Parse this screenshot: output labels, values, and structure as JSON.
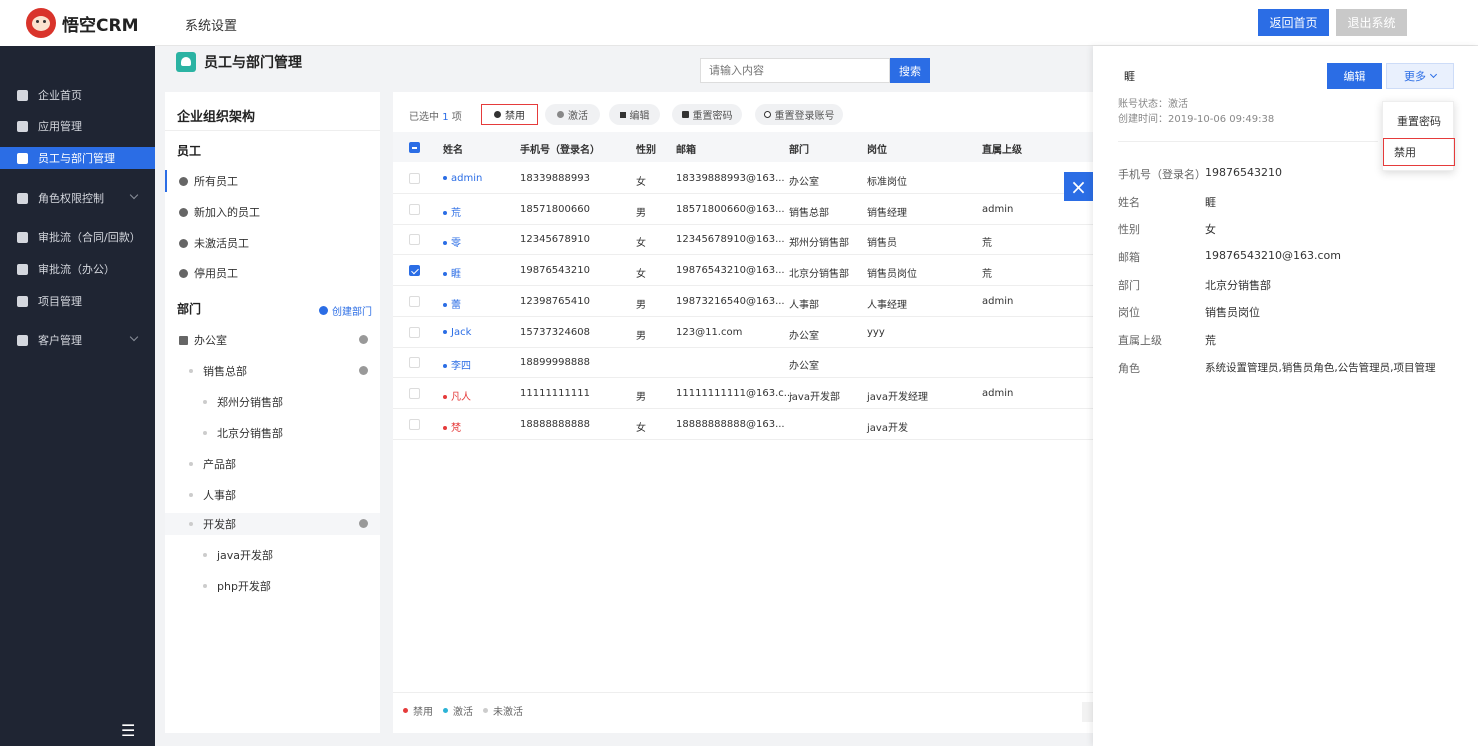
{
  "app": {
    "name": "悟空CRM",
    "section": "系统设置"
  },
  "top_buttons": {
    "home": "返回首页",
    "exit": "退出系统"
  },
  "colors": {
    "primary": "#2b6de5",
    "sidebar_bg": "#1f2533",
    "danger": "#e53b3b",
    "teal": "#2bb3a3"
  },
  "sidebar": {
    "items": [
      {
        "label": "企业首页",
        "icon": "home-icon",
        "active": false,
        "has_arrow": false
      },
      {
        "label": "应用管理",
        "icon": "grid-icon",
        "active": false,
        "has_arrow": false
      },
      {
        "label": "员工与部门管理",
        "icon": "users-icon",
        "active": true,
        "has_arrow": false
      },
      {
        "label": "角色权限控制",
        "icon": "role-icon",
        "active": false,
        "has_arrow": true
      },
      {
        "label": "审批流（合同/回款）",
        "icon": "user-icon",
        "active": false,
        "has_arrow": false
      },
      {
        "label": "审批流（办公）",
        "icon": "monitor-icon",
        "active": false,
        "has_arrow": false
      },
      {
        "label": "项目管理",
        "icon": "list-icon",
        "active": false,
        "has_arrow": false
      },
      {
        "label": "客户管理",
        "icon": "customer-icon",
        "active": false,
        "has_arrow": true
      }
    ],
    "collapse_icon": "collapse-icon"
  },
  "page": {
    "title": "员工与部门管理",
    "search_placeholder": "请输入内容",
    "search_button": "搜索"
  },
  "org": {
    "title": "企业组织架构",
    "staff_section": "员工",
    "staff_items": [
      "所有员工",
      "新加入的员工",
      "未激活员工",
      "停用员工"
    ],
    "dept_section": "部门",
    "create_dept": "创建部门",
    "depts": [
      {
        "label": "办公室",
        "level": 0,
        "gear": true
      },
      {
        "label": "销售总部",
        "level": 1,
        "gear": true
      },
      {
        "label": "郑州分销售部",
        "level": 2,
        "gear": false
      },
      {
        "label": "北京分销售部",
        "level": 2,
        "gear": false
      },
      {
        "label": "产品部",
        "level": 1,
        "gear": false
      },
      {
        "label": "人事部",
        "level": 1,
        "gear": false
      },
      {
        "label": "开发部",
        "level": 1,
        "gear": true
      },
      {
        "label": "java开发部",
        "level": 2,
        "gear": false
      },
      {
        "label": "php开发部",
        "level": 2,
        "gear": false
      }
    ]
  },
  "toolbar": {
    "selected_prefix": "已选中",
    "selected_count": "1",
    "selected_suffix": "项",
    "disable": "禁用",
    "activate": "激活",
    "edit": "编辑",
    "reset_password": "重置密码",
    "reset_account": "重置登录账号"
  },
  "table": {
    "headers": [
      "姓名",
      "手机号（登录名）",
      "性别",
      "邮箱",
      "部门",
      "岗位",
      "直属上级"
    ],
    "rows": [
      {
        "name": "admin",
        "phone": "18339888993",
        "gender": "女",
        "email": "18339888993@163...",
        "dept": "办公室",
        "post": "标准岗位",
        "boss": "",
        "checked": false,
        "status": "active"
      },
      {
        "name": "荒",
        "phone": "18571800660",
        "gender": "男",
        "email": "18571800660@163...",
        "dept": "销售总部",
        "post": "销售经理",
        "boss": "admin",
        "checked": false,
        "status": "active"
      },
      {
        "name": "零",
        "phone": "12345678910",
        "gender": "女",
        "email": "12345678910@163...",
        "dept": "郑州分销售部",
        "post": "销售员",
        "boss": "荒",
        "checked": false,
        "status": "active"
      },
      {
        "name": "睚",
        "phone": "19876543210",
        "gender": "女",
        "email": "19876543210@163...",
        "dept": "北京分销售部",
        "post": "销售员岗位",
        "boss": "荒",
        "checked": true,
        "status": "active"
      },
      {
        "name": "蕾",
        "phone": "12398765410",
        "gender": "男",
        "email": "19873216540@163...",
        "dept": "人事部",
        "post": "人事经理",
        "boss": "admin",
        "checked": false,
        "status": "active"
      },
      {
        "name": "Jack",
        "phone": "15737324608",
        "gender": "男",
        "email": "123@11.com",
        "dept": "办公室",
        "post": "yyy",
        "boss": "",
        "checked": false,
        "status": "active"
      },
      {
        "name": "李四",
        "phone": "18899998888",
        "gender": "",
        "email": "",
        "dept": "办公室",
        "post": "",
        "boss": "",
        "checked": false,
        "status": "active"
      },
      {
        "name": "凡人",
        "phone": "11111111111",
        "gender": "男",
        "email": "11111111111@163.c...",
        "dept": "java开发部",
        "post": "java开发经理",
        "boss": "admin",
        "checked": false,
        "status": "disabled"
      },
      {
        "name": "梵",
        "phone": "18888888888",
        "gender": "女",
        "email": "18888888888@163...",
        "dept": "",
        "post": "java开发",
        "boss": "",
        "checked": false,
        "status": "disabled"
      }
    ]
  },
  "legend": [
    "禁用",
    "激活",
    "未激活"
  ],
  "detail": {
    "name": "睚",
    "edit": "编辑",
    "more": "更多",
    "status_line": "账号状态：激活",
    "created_line": "创建时间：2019-10-06 09:49:38",
    "fields": [
      {
        "label": "手机号（登录名）",
        "value": "19876543210"
      },
      {
        "label": "姓名",
        "value": "睚"
      },
      {
        "label": "性别",
        "value": "女"
      },
      {
        "label": "邮箱",
        "value": "19876543210@163.com"
      },
      {
        "label": "部门",
        "value": "北京分销售部"
      },
      {
        "label": "岗位",
        "value": "销售员岗位"
      },
      {
        "label": "直属上级",
        "value": "荒"
      },
      {
        "label": "角色",
        "value": "系统设置管理员,销售员角色,公告管理员,项目管理"
      }
    ],
    "dropdown": [
      "重置密码",
      "禁用"
    ]
  }
}
